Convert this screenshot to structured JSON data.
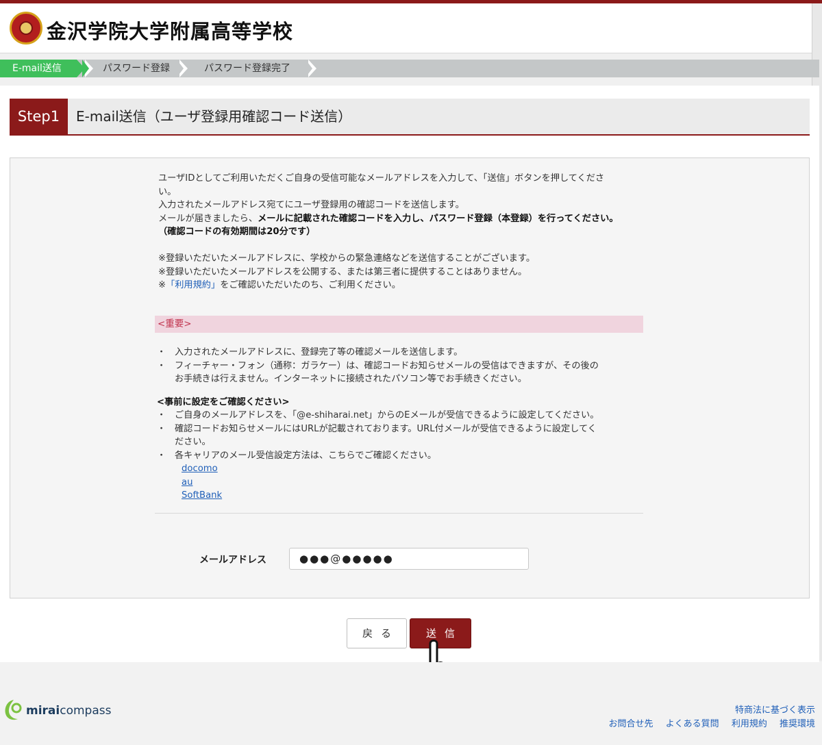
{
  "header": {
    "school_name": "金沢学院大学附属高等学校"
  },
  "progress": {
    "steps": [
      "E-mail送信",
      "パスワード登録",
      "パスワード登録完了"
    ],
    "active_index": 0
  },
  "step": {
    "label": "Step1",
    "title": "E-mail送信（ユーザ登録用確認コード送信）"
  },
  "intro": {
    "line1": "ユーザIDとしてご利用いただくご自身の受信可能なメールアドレスを入力して、「送信」ボタンを押してくださ",
    "line2": "い。",
    "line3": "入力されたメールアドレス宛てにユーザ登録用の確認コードを送信します。",
    "line4_pre": "メールが届きましたら、",
    "line4_bold": "メールに記載された確認コードを入力し、パスワード登録（本登録）を行ってください。",
    "line5_bold": "（確認コードの有効期間は20分です）",
    "note1": "※登録いただいたメールアドレスに、学校からの緊急連絡などを送信することがございます。",
    "note2": "※登録いただいたメールアドレスを公開する、または第三者に提供することはありません。",
    "note3_pre": "※",
    "note3_link": "「利用規約」",
    "note3_post": "をご確認いただいたのち、ご利用ください。"
  },
  "important": {
    "heading": "<重要>",
    "b1": "入力されたメールアドレスに、登録完了等の確認メールを送信します。",
    "b2a": "フィーチャー・フォン（通称：ガラケー）は、確認コードお知らせメールの受信はできますが、その後の",
    "b2b": "お手続きは行えません。インターネットに接続されたパソコン等でお手続きください。",
    "pre_heading": "<事前に設定をご確認ください>",
    "c1": "ご自身のメールアドレスを、「@e-shiharai.net」からのEメールが受信できるように設定してください。",
    "c2a": "確認コードお知らせメールにはURLが記載されております。URL付メールが受信できるように設定してく",
    "c2b": "ださい。",
    "c3": "各キャリアのメール受信設定方法は、こちらでご確認ください。",
    "carriers": [
      "docomo",
      "au",
      "SoftBank"
    ]
  },
  "form": {
    "email_label": "メールアドレス",
    "email_value": "●●●@●●●●●"
  },
  "buttons": {
    "back": "戻る",
    "send": "送信"
  },
  "footer": {
    "brand_bold": "mirai",
    "brand_rest": "compass",
    "link_top": "特商法に基づく表示",
    "links": [
      "お問合せ先",
      "よくある質問",
      "利用規約",
      "推奨環境"
    ]
  },
  "colors": {
    "brand": "#8b1a1a",
    "progress_active": "#3fbf5b",
    "link": "#1f5fb8",
    "important_bg": "#f0d4de"
  }
}
